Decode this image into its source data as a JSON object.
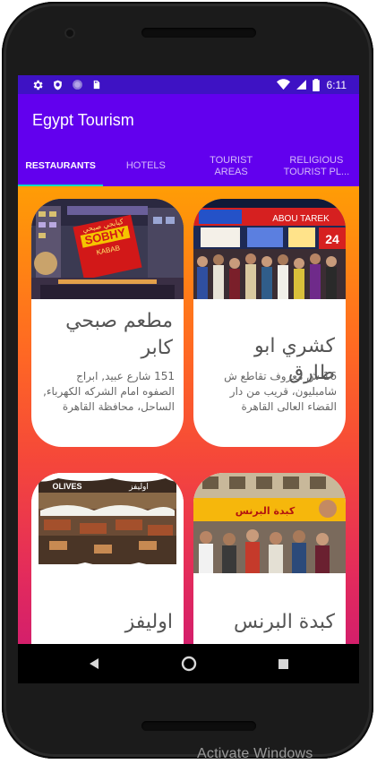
{
  "status_bar": {
    "time": "6:11",
    "left_icons": [
      "settings-icon",
      "shield-icon",
      "circle-icon",
      "sd-card-icon"
    ],
    "right_icons": [
      "wifi-icon",
      "signal-icon",
      "battery-icon"
    ]
  },
  "app_bar": {
    "title": "Egypt Tourism"
  },
  "tabs": [
    {
      "label": "RESTAURANTS",
      "active": true
    },
    {
      "label": "HOTELS",
      "active": false
    },
    {
      "label": "TOURIST AREAS",
      "active": false
    },
    {
      "label": "RELIGIOUS TOURIST PL...",
      "active": false
    }
  ],
  "cards": [
    {
      "name": "كشري ابو طارق",
      "address": "16 ش معروف تقاطع ش شامبليون، قريب من دار القضاء العالى القاهرة"
    },
    {
      "name": "مطعم صبحي كابر",
      "address": "151 شارع عبيد, ابراج الصفوه امام الشركه الكهرباء, الساحل، محافظة القاهرة"
    },
    {
      "name": "كبدة البرنس",
      "address": ""
    },
    {
      "name": "اوليفز",
      "address": ""
    }
  ],
  "image_signs": {
    "sobhy_arabic": "كبابجي صبحي",
    "sobhy_latin": "SOBHY",
    "sobhy_sub": "KABAB",
    "olives_latin": "OLIVES",
    "olives_arabic": "اوليفز",
    "tarek_sign": "ABOU TAREK",
    "tarek_24": "24",
    "prince_sign": "كبدة البرنس"
  },
  "colors": {
    "status_bar": "#3e12c4",
    "primary": "#6200ee",
    "tab_indicator": "#03dac5",
    "gradient_top": "#ff9d05",
    "gradient_bottom": "#d41f6b"
  },
  "nav": {
    "buttons": [
      "back-icon",
      "home-icon",
      "recents-icon"
    ]
  },
  "watermark": "Activate Windows"
}
